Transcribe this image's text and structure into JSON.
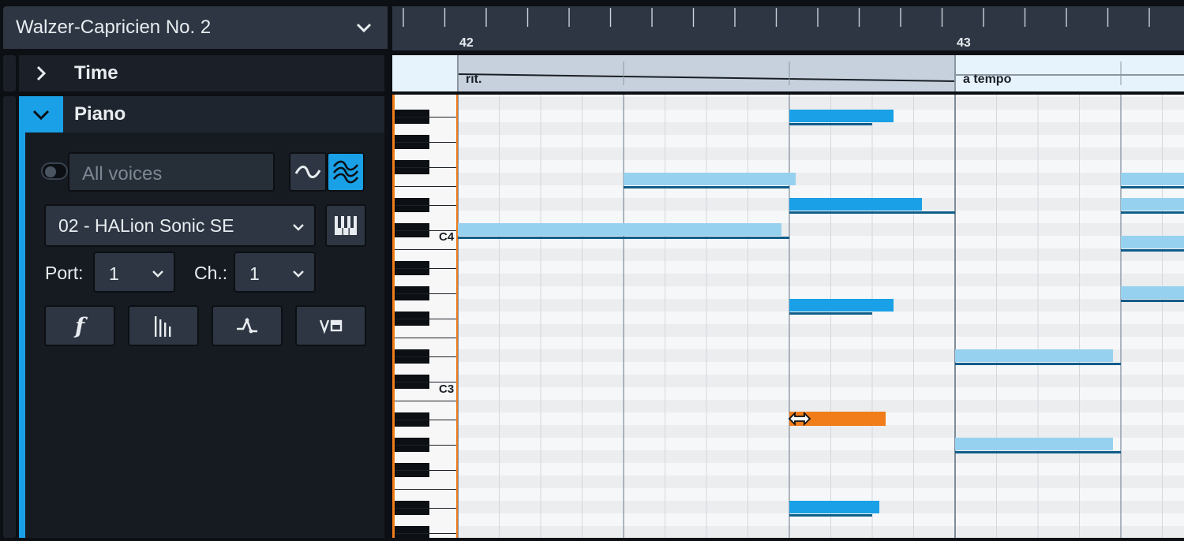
{
  "flow": {
    "title": "Walzer-Capricien No. 2"
  },
  "tracks": {
    "time": "Time",
    "piano": "Piano"
  },
  "piano": {
    "voices_placeholder": "All voices",
    "instrument": "02 - HALion Sonic SE",
    "port_label": "Port:",
    "port_value": "1",
    "channel_label": "Ch.:",
    "channel_value": "1",
    "dynamics_glyph": "f"
  },
  "ruler": {
    "bar_42": "42",
    "bar_43": "43"
  },
  "tempo": {
    "rit": "rit.",
    "a_tempo": "a tempo"
  },
  "keyboard": {
    "c4": "C4",
    "c3": "C3"
  },
  "colors": {
    "note_selected": "#1aa0e6",
    "note_unselected": "#97d1f0",
    "note_edit": "#f07c1a",
    "accent": "#1aa0e6"
  }
}
